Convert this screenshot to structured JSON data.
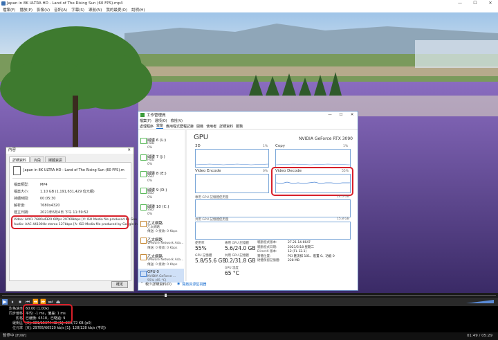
{
  "player": {
    "title": "Japan in 8K ULTRA HD - Land of The Rising Sun (60 FPS).mp4",
    "menu": [
      "檔案(F)",
      "播放(P)",
      "影像(V)",
      "音訊(A)",
      "字幕(S)",
      "導航(N)",
      "我的最愛(O)",
      "說明(H)"
    ],
    "window_controls": [
      "—",
      "☐",
      "✕"
    ],
    "time": "01:49 / 05:29",
    "status_left": "暫停中 [H/W]",
    "controls": [
      "▶",
      "⏸",
      "⏹",
      "⏮",
      "⏪",
      "⏩",
      "⏭",
      "⏏"
    ],
    "stats": [
      {
        "k": "影格速率",
        "v": "60.00 (1.00x)"
      },
      {
        "k": "同步偏移",
        "v": "平均: -1 ms，偏差: 1 ms"
      },
      {
        "k": "影格",
        "v": "已緩衝: 6518，已略過: 9"
      },
      {
        "k": "緩衝區",
        "v": "[0]: 381/15674 KB [1]: 200/72 KB (p0)"
      },
      {
        "k": "位元率",
        "v": "[0]: 29785/60520 kb/s [1]: 128/128 kb/s (平均)"
      }
    ]
  },
  "properties": {
    "title": "內容",
    "tabs": [
      "詳細資料",
      "片段",
      "媒體資訊"
    ],
    "filename": "Japan in 8K ULTRA HD - Land of The Rising Sun (60 FPS).m",
    "rows": [
      {
        "k": "檔案類型:",
        "v": "MP4"
      },
      {
        "k": "檔案大小:",
        "v": "1.10 GB (1,191,631,429 位元組)"
      },
      {
        "k": "持續時間:",
        "v": "00:05:30"
      },
      {
        "k": "解析度:",
        "v": "7680x4320"
      },
      {
        "k": "建立日期:",
        "v": "2021年6月4日 下午 11:59:52"
      }
    ],
    "video_line": "Video: AV01 7680x4320 60fps 29769kbps [V: ISO Media file produced by Goo",
    "audio_line": "Audio: AAC 44100Hz stereo 127kbps [A: ISO Media file produced by Google In",
    "ok_label": "確定"
  },
  "taskmgr": {
    "title": "工作管理員",
    "menu": [
      "檔案(F)",
      "選項(O)",
      "檢視(V)"
    ],
    "tabs": [
      "處理程序",
      "效能",
      "應用程式歷程記錄",
      "開機",
      "使用者",
      "詳細資料",
      "服務"
    ],
    "side": [
      {
        "l1": "磁碟 6 (L:)",
        "l2": "HDD",
        "l3": "0%"
      },
      {
        "l1": "磁碟 7 (J:)",
        "l2": "HDD",
        "l3": "0%"
      },
      {
        "l1": "磁碟 8 (E:)",
        "l2": "SSD",
        "l3": "0%"
      },
      {
        "l1": "磁碟 9 (D:)",
        "l2": "SSD",
        "l3": "0%"
      },
      {
        "l1": "磁碟 10 (C:)",
        "l2": "SSD",
        "l3": "0%"
      },
      {
        "l1": "乙太網路",
        "l2": "乙太網路",
        "l3": "傳送: 0 接收: 0 Kbps"
      },
      {
        "l1": "乙太網路",
        "l2": "VMware Network Ada...",
        "l3": "傳送: 0 接收: 0 Kbps"
      },
      {
        "l1": "乙太網路",
        "l2": "VMware Network Ada...",
        "l3": "傳送: 0 接收: 0 Kbps"
      },
      {
        "l1": "GPU 0",
        "l2": "NVIDIA GeForce ...",
        "l3": "55% (65 °C)"
      }
    ],
    "gpu_title": "GPU",
    "gpu_name": "NVIDIA GeForce RTX 3090",
    "g3d": "3D",
    "g3d_pct": "1%",
    "gcopy": "Copy",
    "gcopy_pct": "1%",
    "genc": "Video Encode",
    "genc_pct": "0%",
    "gdec": "Video Decode",
    "gdec_pct": "55%",
    "ded_label": "專用 GPU 記憶體使用量",
    "ded_max": "24.0 GB",
    "shared_label": "共用 GPU 記憶體使用量",
    "shared_max": "15.8 GB",
    "stats": [
      {
        "k": "使用率",
        "v": "55%"
      },
      {
        "k": "專用 GPU 記憶體",
        "v": "5.6/24.0 GB"
      },
      {
        "k": "GPU 記憶體",
        "v": "5.8/55.6 GB"
      },
      {
        "k": "共用 GPU 記憶體",
        "v": "0.2/31.8 GB"
      },
      {
        "k": "GPU 溫度",
        "v": "65 °C"
      }
    ],
    "info": [
      {
        "k": "驅動程式版本:",
        "v": "27.21.14.6647"
      },
      {
        "k": "驅動程式日期:",
        "v": "2021/5/18 星期二"
      },
      {
        "k": "DirectX 版本:",
        "v": "12 (FL 12.1)"
      },
      {
        "k": "實體位置:",
        "v": "PCI 匯流排 101、裝置 0、功能 0"
      },
      {
        "k": "硬體保留記憶體:",
        "v": "228 MB"
      }
    ],
    "foot_less": "較少詳細資料(D)",
    "foot_open": "開啟資源監視器"
  }
}
